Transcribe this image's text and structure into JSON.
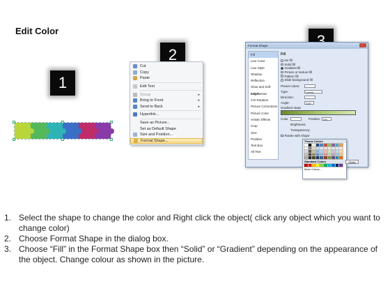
{
  "title": "Edit Color",
  "steps": [
    "1",
    "2",
    "3"
  ],
  "strip_colors": [
    "#b8d63a",
    "#55b85a",
    "#2eb4b4",
    "#3a6fc8",
    "#c02b6a",
    "#8a3aa8"
  ],
  "context_menu": {
    "items": [
      {
        "label": "Cut",
        "icon": "scissors-icon",
        "color": "#6b8fc9"
      },
      {
        "label": "Copy",
        "icon": "copy-icon",
        "color": "#8aaed8"
      },
      {
        "label": "Paste",
        "icon": "paste-icon",
        "color": "#d2a64a"
      },
      {
        "sep": true
      },
      {
        "label": "Edit Text",
        "icon": "edit-text-icon",
        "color": "#c6c6c6"
      },
      {
        "sep": true
      },
      {
        "label": "Group",
        "icon": "group-icon",
        "color": "#bbbbbb",
        "arrow": true,
        "disabled": true
      },
      {
        "label": "Bring to Front",
        "icon": "bring-front-icon",
        "color": "#5a84c4",
        "arrow": true
      },
      {
        "label": "Send to Back",
        "icon": "send-back-icon",
        "color": "#5a84c4",
        "arrow": true
      },
      {
        "sep": true
      },
      {
        "label": "Hyperlink...",
        "icon": "hyperlink-icon",
        "color": "#4a78c0"
      },
      {
        "sep": true
      },
      {
        "label": "Save as Picture...",
        "icon": "",
        "color": "transparent"
      },
      {
        "label": "Set as Default Shape",
        "icon": "",
        "color": "transparent"
      },
      {
        "label": "Size and Position...",
        "icon": "size-icon",
        "color": "#9cb6d8"
      },
      {
        "label": "Format Shape...",
        "icon": "format-shape-icon",
        "color": "#e2b04a",
        "highlight": true
      }
    ]
  },
  "dialog": {
    "title": "Format Shape",
    "side_items": [
      "Fill",
      "Line Color",
      "Line Style",
      "Shadow",
      "Reflection",
      "Glow and Soft Edges",
      "3-D Format",
      "3-D Rotation",
      "Picture Corrections",
      "Picture Color",
      "Artistic Effects",
      "Crop",
      "Size",
      "Position",
      "Text Box",
      "Alt Text"
    ],
    "selected_side": "Fill",
    "pane_heading": "Fill",
    "radios": [
      {
        "label": "No fill",
        "on": false
      },
      {
        "label": "Solid fill",
        "on": false
      },
      {
        "label": "Gradient fill",
        "on": true
      },
      {
        "label": "Picture or texture fill",
        "on": false
      },
      {
        "label": "Pattern fill",
        "on": false
      },
      {
        "label": "Slide background fill",
        "on": false
      }
    ],
    "preset_label": "Preset colors:",
    "type_label": "Type:",
    "type_value": "Linear",
    "direction_label": "Direction:",
    "angle_label": "Angle:",
    "angle_value": "225°",
    "stops_label": "Gradient stops",
    "color_label": "Color",
    "position_label": "Position:",
    "position_value": "0%",
    "brightness_label": "Brightness:",
    "transparency_label": "Transparency:",
    "rotate_label": "Rotate with shape",
    "theme_label": "Theme Colors",
    "standard_label": "Standard Colors",
    "more_label": "More Colors...",
    "close_label": "Close"
  },
  "theme_colors": [
    "#ffffff",
    "#000000",
    "#eeece1",
    "#1f497d",
    "#4f81bd",
    "#c0504d",
    "#9bbb59",
    "#8064a2",
    "#4bacc6",
    "#f79646",
    "#f2f2f2",
    "#7f7f7f",
    "#ddd9c3",
    "#c6d9f0",
    "#dbe5f1",
    "#f2dcdb",
    "#ebf1dd",
    "#e5e0ec",
    "#dbeef3",
    "#fdeada",
    "#d8d8d8",
    "#595959",
    "#c4bd97",
    "#8db3e2",
    "#b8cce4",
    "#e5b9b7",
    "#d7e3bc",
    "#ccc1d9",
    "#b7dde8",
    "#fbd5b5",
    "#bfbfbf",
    "#3f3f3f",
    "#938953",
    "#548dd4",
    "#95b3d7",
    "#d99694",
    "#c3d69b",
    "#b2a2c7",
    "#92cddc",
    "#fac08f",
    "#a5a5a5",
    "#262626",
    "#494429",
    "#17365d",
    "#366092",
    "#953734",
    "#76923c",
    "#5f497a",
    "#31859b",
    "#e36c09"
  ],
  "standard_colors": [
    "#c00000",
    "#ff0000",
    "#ffc000",
    "#ffff00",
    "#92d050",
    "#00b050",
    "#00b0f0",
    "#0070c0",
    "#002060",
    "#7030a0"
  ],
  "instructions": [
    {
      "num": "1.",
      "text": "Select the shape to change the color and Right click the object( click any object which you want to change color)"
    },
    {
      "num": "2.",
      "text": "Choose Format Shape in the dialog box."
    },
    {
      "num": "3.",
      "text": "Choose “Fill” in the Format Shape box then “Solid” or “Gradient” depending on the appearance of the object. Change colour as shown in the picture."
    }
  ]
}
